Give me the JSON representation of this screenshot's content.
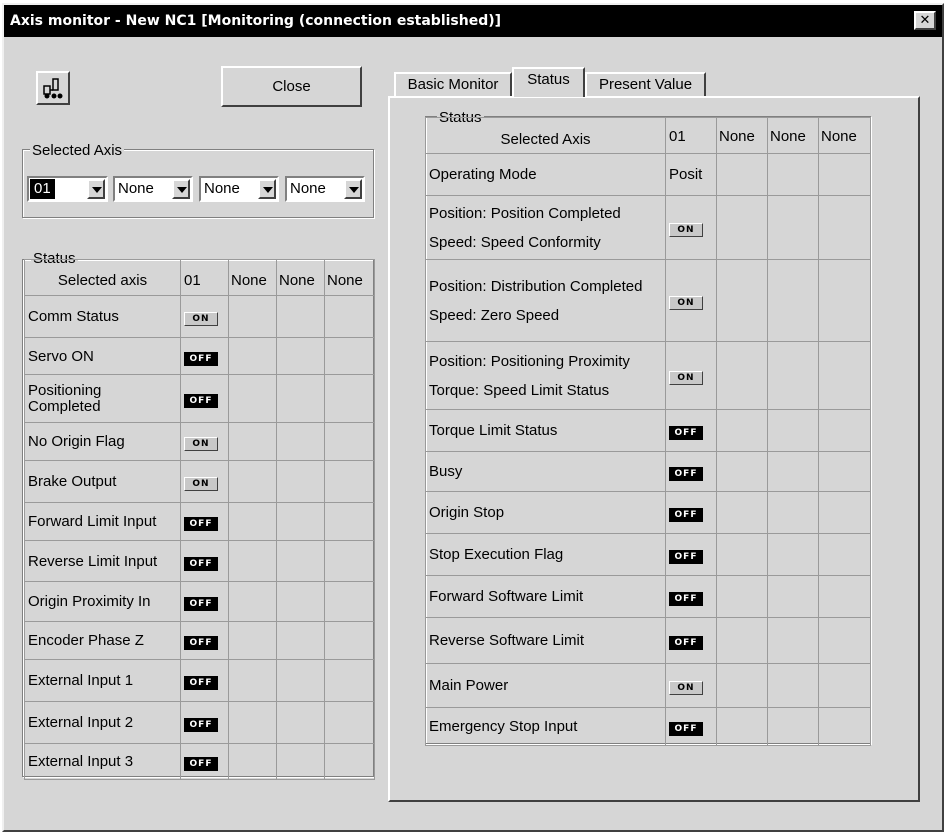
{
  "window": {
    "title": "Axis monitor - New NC1 [Monitoring (connection established)]",
    "close_glyph": "✕"
  },
  "toolbar": {
    "icon": "axis-icon",
    "close_label": "Close"
  },
  "selected_axis": {
    "label": "Selected Axis",
    "combos": [
      {
        "value": "01",
        "selected": true
      },
      {
        "value": "None"
      },
      {
        "value": "None"
      },
      {
        "value": "None"
      }
    ]
  },
  "left_status": {
    "label": "Status",
    "header": [
      "Selected axis",
      "01",
      "None",
      "None",
      "None"
    ],
    "rows": [
      {
        "label": "Comm Status",
        "state": "ON"
      },
      {
        "label": "Servo ON",
        "state": "OFF"
      },
      {
        "label": "Positioning Completed",
        "state": "OFF"
      },
      {
        "label": "No Origin Flag",
        "state": "ON"
      },
      {
        "label": "Brake Output",
        "state": "ON"
      },
      {
        "label": "Forward Limit Input",
        "state": "OFF"
      },
      {
        "label": "Reverse Limit Input",
        "state": "OFF"
      },
      {
        "label": "Origin Proximity In",
        "state": "OFF"
      },
      {
        "label": "Encoder Phase Z",
        "state": "OFF"
      },
      {
        "label": "External Input 1",
        "state": "OFF"
      },
      {
        "label": "External Input 2",
        "state": "OFF"
      },
      {
        "label": "External Input 3",
        "state": "OFF"
      }
    ]
  },
  "tabs": [
    {
      "label": "Basic Monitor"
    },
    {
      "label": "Status",
      "active": true
    },
    {
      "label": "Present Value"
    }
  ],
  "right_status": {
    "label": "Status",
    "header": [
      "Selected Axis",
      "01",
      "None",
      "None",
      "None"
    ],
    "rows": [
      {
        "label": "Operating Mode",
        "value": "Posit"
      },
      {
        "label": "Position: Position Completed",
        "label2": "Speed: Speed Conformity",
        "state": "ON"
      },
      {
        "label": "Position: Distribution Completed",
        "label2": "Speed: Zero Speed",
        "state": "ON"
      },
      {
        "label": "Position: Positioning Proximity",
        "label2": "Torque: Speed Limit Status",
        "state": "ON"
      },
      {
        "label": "Torque Limit Status",
        "state": "OFF"
      },
      {
        "label": "Busy",
        "state": "OFF"
      },
      {
        "label": "Origin Stop",
        "state": "OFF"
      },
      {
        "label": "Stop Execution Flag",
        "state": "OFF"
      },
      {
        "label": "Forward Software Limit",
        "state": "OFF"
      },
      {
        "label": "Reverse Software Limit",
        "state": "OFF"
      },
      {
        "label": "Main Power",
        "state": "ON"
      },
      {
        "label": "Emergency Stop Input",
        "state": "OFF"
      }
    ]
  }
}
